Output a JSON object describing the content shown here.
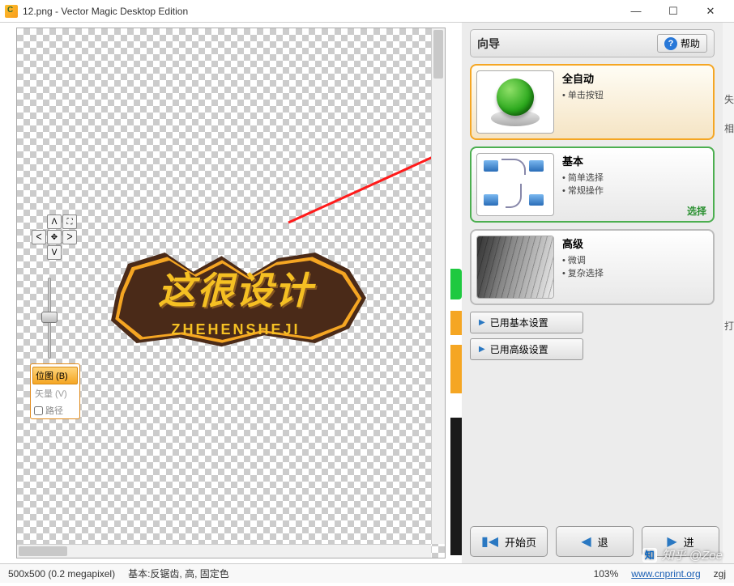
{
  "titlebar": {
    "text": "12.png - Vector Magic Desktop Edition"
  },
  "logo": {
    "line1": "这很设计",
    "line2": "ZHEHENSHEJI"
  },
  "nav": {
    "up": "ᐱ",
    "down": "ᐯ",
    "left": "ᐸ",
    "right": "ᐳ",
    "center": "✥",
    "corner": "⛶"
  },
  "modes": {
    "bitmap": "位图 (B)",
    "vector": "矢量 (V)",
    "path": "路径"
  },
  "wizard": {
    "title": "向导",
    "help": "帮助",
    "options": [
      {
        "title": "全自动",
        "bullets": [
          "单击按钮"
        ],
        "tag": ""
      },
      {
        "title": "基本",
        "bullets": [
          "简单选择",
          "常规操作"
        ],
        "tag": "选择"
      },
      {
        "title": "高级",
        "bullets": [
          "微调",
          "复杂选择"
        ],
        "tag": ""
      }
    ],
    "settings": {
      "basic": "已用基本设置",
      "advanced": "已用高级设置"
    },
    "navbtn": {
      "home": "开始页",
      "back": "退",
      "forward": "进"
    }
  },
  "status": {
    "dims": "500x500 (0.2 megapixel)",
    "info": "基本:反锯齿, 高, 固定色",
    "zoom": "103%",
    "link": "www.cnprint.org",
    "user": "zgj"
  },
  "edge": {
    "c1": "失",
    "c2": "相",
    "c3": "打"
  },
  "watermark": "知乎 @Zoe"
}
